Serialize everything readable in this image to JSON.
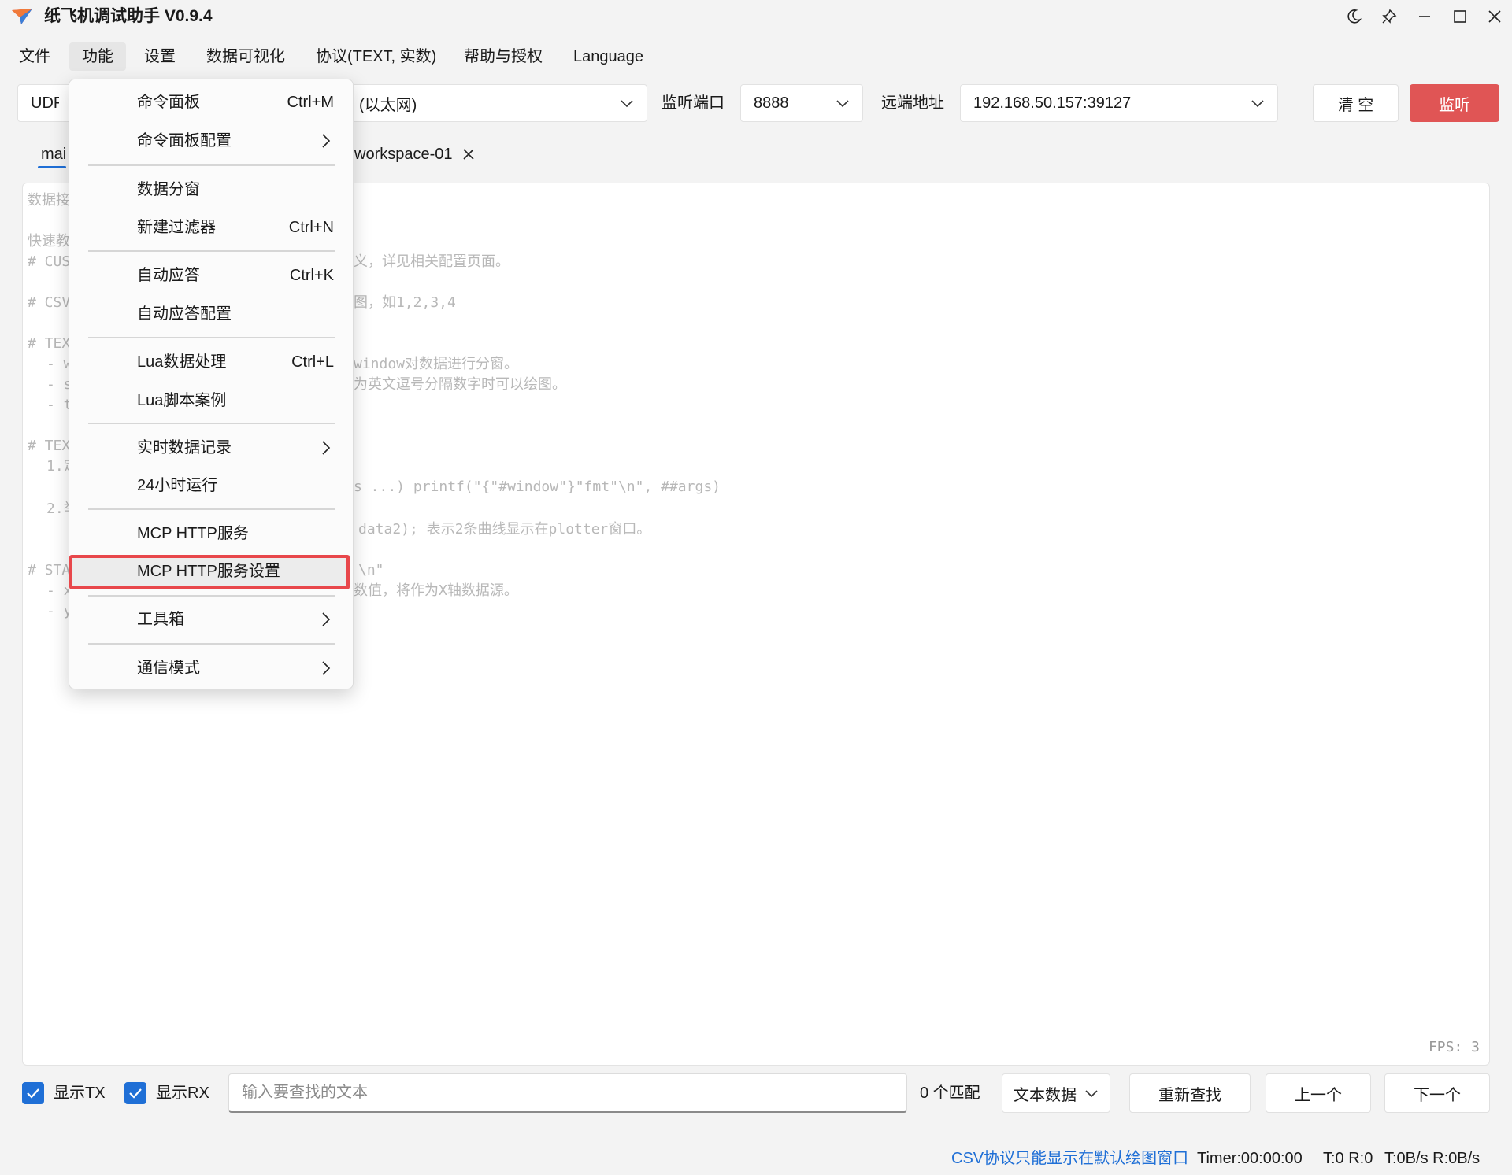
{
  "titlebar": {
    "title": "纸飞机调试助手 V0.9.4",
    "icons": [
      "moon-icon",
      "pin-icon",
      "minimize-icon",
      "maximize-icon",
      "close-icon"
    ]
  },
  "menubar": {
    "items": [
      "文件",
      "功能",
      "设置",
      "数据可视化",
      "协议(TEXT, 实数)",
      "帮助与授权",
      "Language"
    ],
    "active": "功能"
  },
  "toolbar": {
    "protocol": "UDP",
    "interface": "(以太网)",
    "listen_port_label": "监听端口",
    "listen_port": "8888",
    "remote_label": "远端地址",
    "remote_address": "192.168.50.157:39127",
    "clear_label": "清 空",
    "listen_label": "监听"
  },
  "tabs": {
    "main_label": "mai",
    "workspace_label": "workspace-01"
  },
  "data_area": {
    "ghost_lines": [
      "数据接",
      "快速教",
      "# CUS",
      "义，详见相关配置页面。",
      "# CSV",
      "图，如1,2,3,4",
      "# TEX",
      "- w",
      "window对数据进行分窗。",
      "- s",
      "为英文逗号分隔数字时可以绘图。",
      "- t",
      "# TEX",
      "1.定",
      "s ...) printf(\"{\"#window\"}\"fmt\"\\n\", ##args)",
      "2.举",
      "data2); 表示2条曲线显示在plotter窗口。",
      "# STA",
      "\\n\"",
      "- x",
      "数值，将作为X轴数据源。",
      "- y"
    ],
    "fps": "FPS: 3"
  },
  "dropdown": {
    "items": [
      {
        "label": "命令面板",
        "shortcut": "Ctrl+M"
      },
      {
        "label": "命令面板配置",
        "submenu": true
      },
      {
        "label": "数据分窗"
      },
      {
        "label": "新建过滤器",
        "shortcut": "Ctrl+N"
      },
      {
        "label": "自动应答",
        "shortcut": "Ctrl+K"
      },
      {
        "label": "自动应答配置"
      },
      {
        "label": "Lua数据处理",
        "shortcut": "Ctrl+L"
      },
      {
        "label": "Lua脚本案例"
      },
      {
        "label": "实时数据记录",
        "submenu": true
      },
      {
        "label": "24小时运行"
      },
      {
        "label": "MCP HTTP服务"
      },
      {
        "label": "MCP HTTP服务设置",
        "highlighted": true
      },
      {
        "label": "工具箱",
        "submenu": true
      },
      {
        "label": "通信模式",
        "submenu": true
      }
    ]
  },
  "bottom": {
    "show_tx_label": "显示TX",
    "show_rx_label": "显示RX",
    "show_tx_checked": true,
    "show_rx_checked": true,
    "search_placeholder": "输入要查找的文本",
    "match_count": "0 个匹配",
    "data_type": "文本数据",
    "refind_label": "重新查找",
    "prev_label": "上一个",
    "next_label": "下一个"
  },
  "status": {
    "hint": "CSV协议只能显示在默认绘图窗口",
    "timer": "Timer:00:00:00",
    "counts": "T:0 R:0",
    "rates": "T:0B/s R:0B/s"
  },
  "colors": {
    "accent": "#1f6fd6",
    "primary_button": "#e05555",
    "highlight_border": "#e8474b",
    "status_hint": "#1f6fd6"
  }
}
